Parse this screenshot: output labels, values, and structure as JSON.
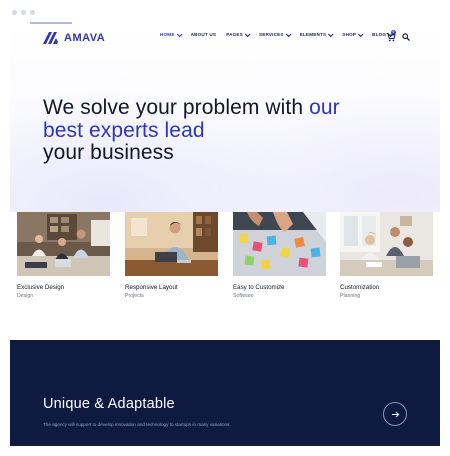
{
  "window": {
    "dots": [
      "dot-1",
      "dot-2",
      "dot-3"
    ]
  },
  "header": {
    "logo_text": "AMAVA",
    "nav": [
      {
        "label": "HOME",
        "has_dropdown": true,
        "active": true
      },
      {
        "label": "ABOUT US",
        "has_dropdown": false,
        "active": false
      },
      {
        "label": "PAGES",
        "has_dropdown": true,
        "active": false
      },
      {
        "label": "SERVICES",
        "has_dropdown": true,
        "active": false
      },
      {
        "label": "ELEMENTS",
        "has_dropdown": true,
        "active": false
      },
      {
        "label": "SHOP",
        "has_dropdown": true,
        "active": false
      },
      {
        "label": "BLOG",
        "has_dropdown": true,
        "active": false
      }
    ],
    "cart_count": "0",
    "icons": {
      "cart": "cart-icon",
      "search": "search-icon"
    }
  },
  "hero": {
    "line1_plain": "We solve your problem with ",
    "line1_accent": "our",
    "line2_accent": "best experts lead",
    "line3_plain": "your business"
  },
  "cards": [
    {
      "title": "Exclusive Design",
      "subtitle": "Design"
    },
    {
      "title": "Responsive Layout",
      "subtitle": "Projects"
    },
    {
      "title": "Easy to Customize",
      "subtitle": "Software"
    },
    {
      "title": "Customization",
      "subtitle": "Planning"
    }
  ],
  "band": {
    "title": "Unique & Adaptable",
    "subtitle": "The agency will support to develop innovation and technology to startups in many variations.",
    "button_icon": "arrow-right-icon"
  },
  "colors": {
    "brand": "#2f35b7",
    "heading": "#111827",
    "band_bg": "#0e1a3f",
    "band_text": "#ffffff"
  }
}
